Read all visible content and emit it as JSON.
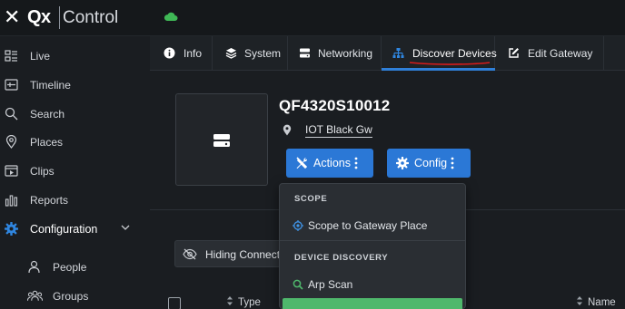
{
  "app": {
    "close_glyph": "✕",
    "logo": "Qx",
    "title": "Control",
    "cloud_status": "cloud-connected",
    "colors": {
      "accent": "#2b78d6",
      "cloud": "#3fb856",
      "green": "#4fb86c",
      "underline": "#2f7fd8",
      "annotation": "#d81b1b"
    }
  },
  "sidebar": {
    "items": [
      {
        "label": "Live",
        "icon": "live-grid-icon"
      },
      {
        "label": "Timeline",
        "icon": "timeline-icon"
      },
      {
        "label": "Search",
        "icon": "search-icon"
      },
      {
        "label": "Places",
        "icon": "map-pin-icon"
      },
      {
        "label": "Clips",
        "icon": "clips-icon"
      },
      {
        "label": "Reports",
        "icon": "reports-icon"
      },
      {
        "label": "Configuration",
        "icon": "gear-icon",
        "active": true,
        "expanded": true
      }
    ],
    "sub_items": [
      {
        "label": "People",
        "icon": "person-icon"
      },
      {
        "label": "Groups",
        "icon": "group-icon"
      }
    ]
  },
  "tabs": [
    {
      "label": "Info",
      "icon": "info-icon"
    },
    {
      "label": "System",
      "icon": "layers-icon"
    },
    {
      "label": "Networking",
      "icon": "server-icon"
    },
    {
      "label": "Discover Devices",
      "icon": "network-icon",
      "active": true
    },
    {
      "label": "Edit Gateway",
      "icon": "edit-icon"
    }
  ],
  "device": {
    "name": "QF4320S10012",
    "place": "IOT Black Gw",
    "icon": "gateway-device-icon"
  },
  "buttons": {
    "actions": "Actions",
    "config": "Config"
  },
  "filter": {
    "label": "Hiding Connected"
  },
  "table": {
    "columns": [
      "Type",
      "Name"
    ]
  },
  "dropdown": {
    "sections": [
      {
        "title": "SCOPE",
        "items": [
          {
            "label": "Scope to Gateway Place",
            "icon": "target-icon"
          }
        ]
      },
      {
        "title": "DEVICE DISCOVERY",
        "items": [
          {
            "label": "Arp Scan",
            "icon": "search-icon"
          }
        ]
      }
    ]
  }
}
